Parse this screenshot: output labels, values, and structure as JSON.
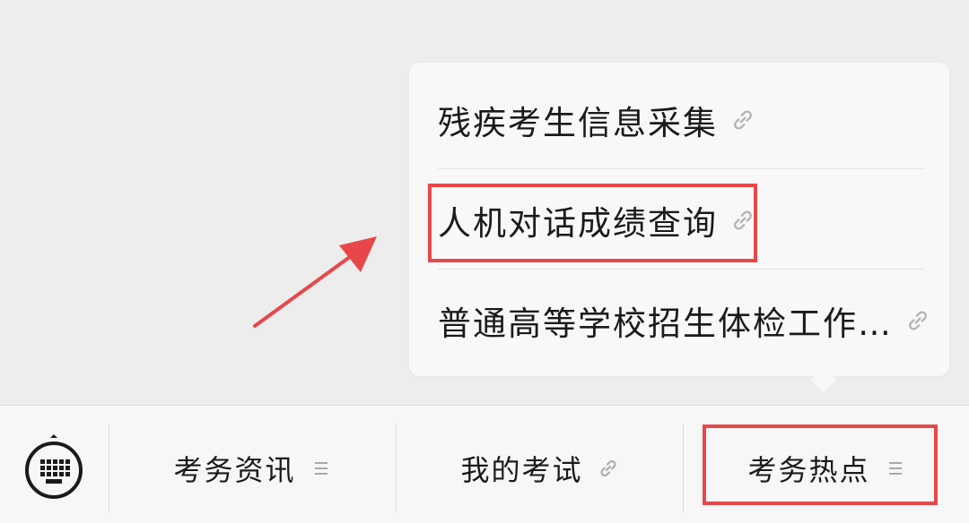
{
  "popup": {
    "items": [
      {
        "label": "残疾考生信息采集",
        "icon": "link-icon"
      },
      {
        "label": "人机对话成绩查询",
        "icon": "link-icon"
      },
      {
        "label": "普通高等学校招生体检工作…",
        "icon": "link-icon"
      }
    ]
  },
  "menubar": {
    "keyboard_icon": "keyboard-icon",
    "tabs": [
      {
        "label": "考务资讯",
        "icon": "menu-lines-icon"
      },
      {
        "label": "我的考试",
        "icon": "link-icon"
      },
      {
        "label": "考务热点",
        "icon": "menu-lines-icon"
      }
    ]
  },
  "annotations": {
    "highlight_color": "#e8474a"
  }
}
